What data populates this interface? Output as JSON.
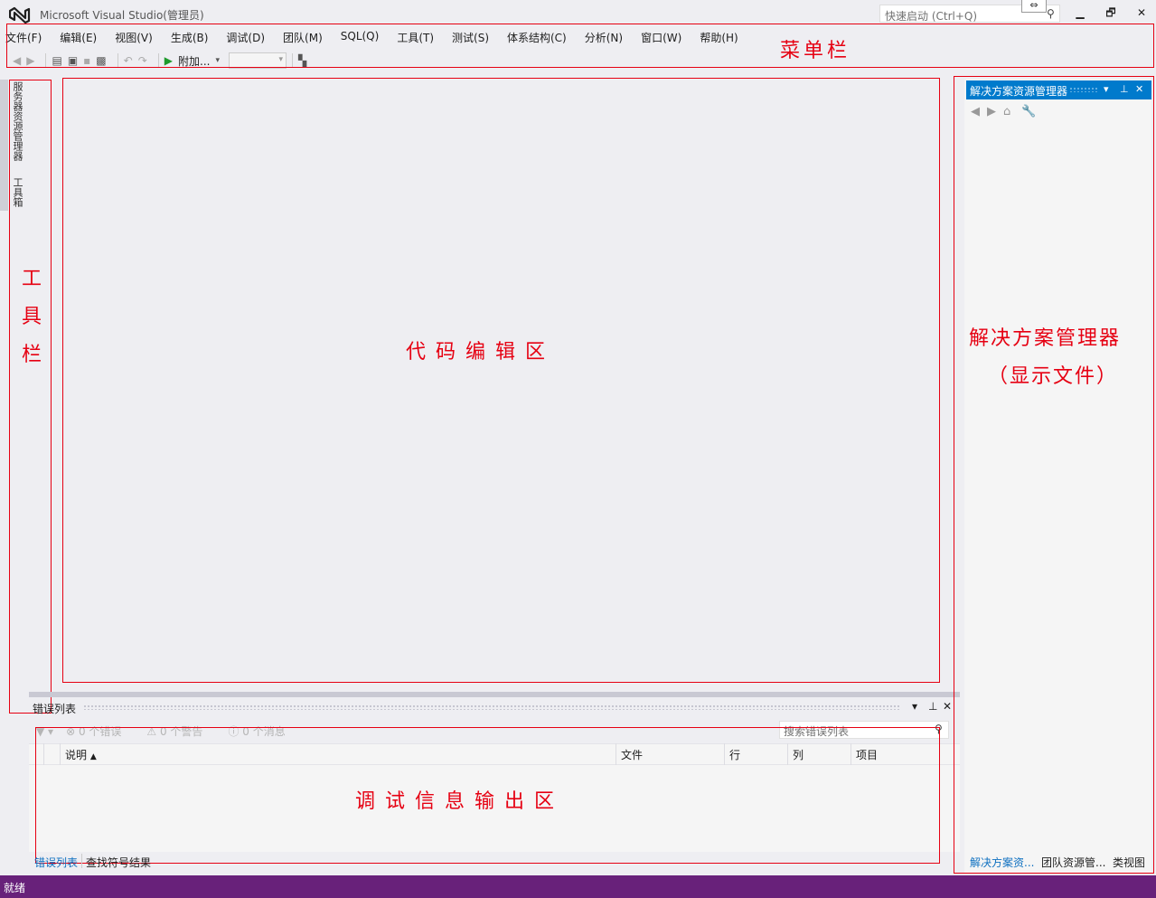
{
  "titlebar": {
    "title": "Microsoft Visual Studio(管理员)",
    "quick_launch_placeholder": "快速启动 (Ctrl+Q)",
    "minimize": "▁",
    "restore": "🗗",
    "close": "✕"
  },
  "menu": [
    "文件(F)",
    "编辑(E)",
    "视图(V)",
    "生成(B)",
    "调试(D)",
    "团队(M)",
    "SQL(Q)",
    "工具(T)",
    "测试(S)",
    "体系结构(C)",
    "分析(N)",
    "窗口(W)",
    "帮助(H)"
  ],
  "toolbar": {
    "attach_label": "附加..."
  },
  "side": {
    "server_explorer": "服务器资源管理器",
    "toolbox": "工具箱"
  },
  "annotations": {
    "menubar": "菜单栏",
    "toolbox": [
      "工",
      "具",
      "栏"
    ],
    "editor": "代 码 编 辑 区",
    "solution": "解决方案管理器",
    "solution_sub": "（显示文件）",
    "output": "调 试 信 息 输 出 区"
  },
  "error_list": {
    "title": "错误列表",
    "errors": "0 个错误",
    "warnings": "0 个警告",
    "messages": "0 个消息",
    "search_placeholder": "搜索错误列表",
    "columns": {
      "desc": "说明",
      "file": "文件",
      "line": "行",
      "col": "列",
      "project": "项目"
    },
    "tabs": [
      "错误列表",
      "查找符号结果"
    ]
  },
  "solution_explorer": {
    "title": "解决方案资源管理器",
    "tabs": [
      "解决方案资...",
      "团队资源管...",
      "类视图"
    ]
  },
  "status": {
    "text": "就绪"
  },
  "colors": {
    "accent": "#007acc",
    "status_bar": "#68217a",
    "annotation": "#e60012"
  }
}
